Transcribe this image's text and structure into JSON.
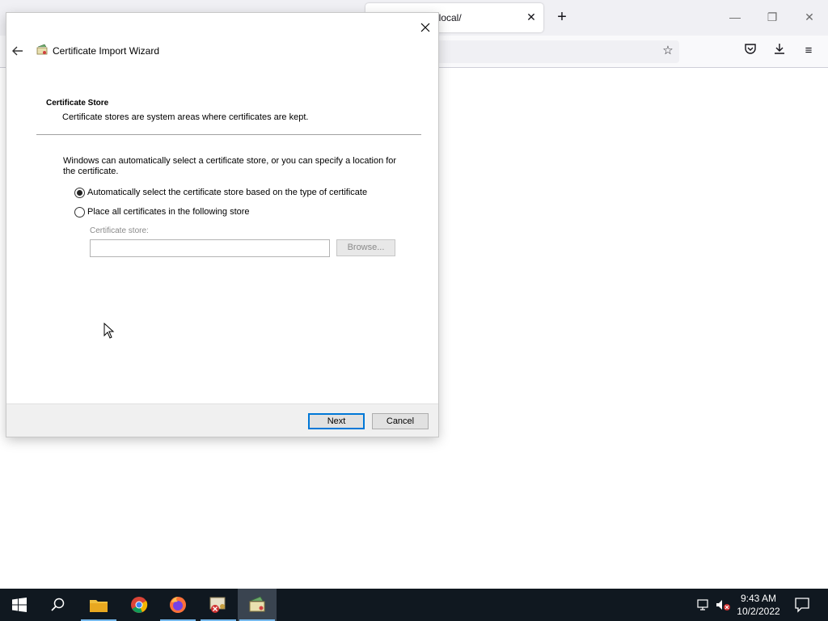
{
  "browser": {
    "tab_title": "t.local/",
    "tab_close_icon": "close-icon",
    "new_tab_icon": "plus-icon"
  },
  "dialog": {
    "title": "Certificate Import Wizard",
    "section_heading": "Certificate Store",
    "section_description": "Certificate stores are system areas where certificates are kept.",
    "body_text": "Windows can automatically select a certificate store, or you can specify a location for the certificate.",
    "options": [
      {
        "label": "Automatically select the certificate store based on the type of certificate",
        "selected": true
      },
      {
        "label": "Place all certificates in the following store",
        "selected": false
      }
    ],
    "store_label": "Certificate store:",
    "store_value": "",
    "browse_label": "Browse...",
    "next_label": "Next",
    "cancel_label": "Cancel"
  },
  "taskbar": {
    "pinned": [
      "start-icon",
      "search-icon",
      "file-explorer-icon",
      "chrome-icon",
      "firefox-icon",
      "certificate-error-icon",
      "certificate-wizard-icon"
    ],
    "clock_time": "9:43 AM",
    "clock_date": "10/2/2022"
  },
  "colors": {
    "accent": "#0078d7",
    "taskbar": "#101820"
  }
}
